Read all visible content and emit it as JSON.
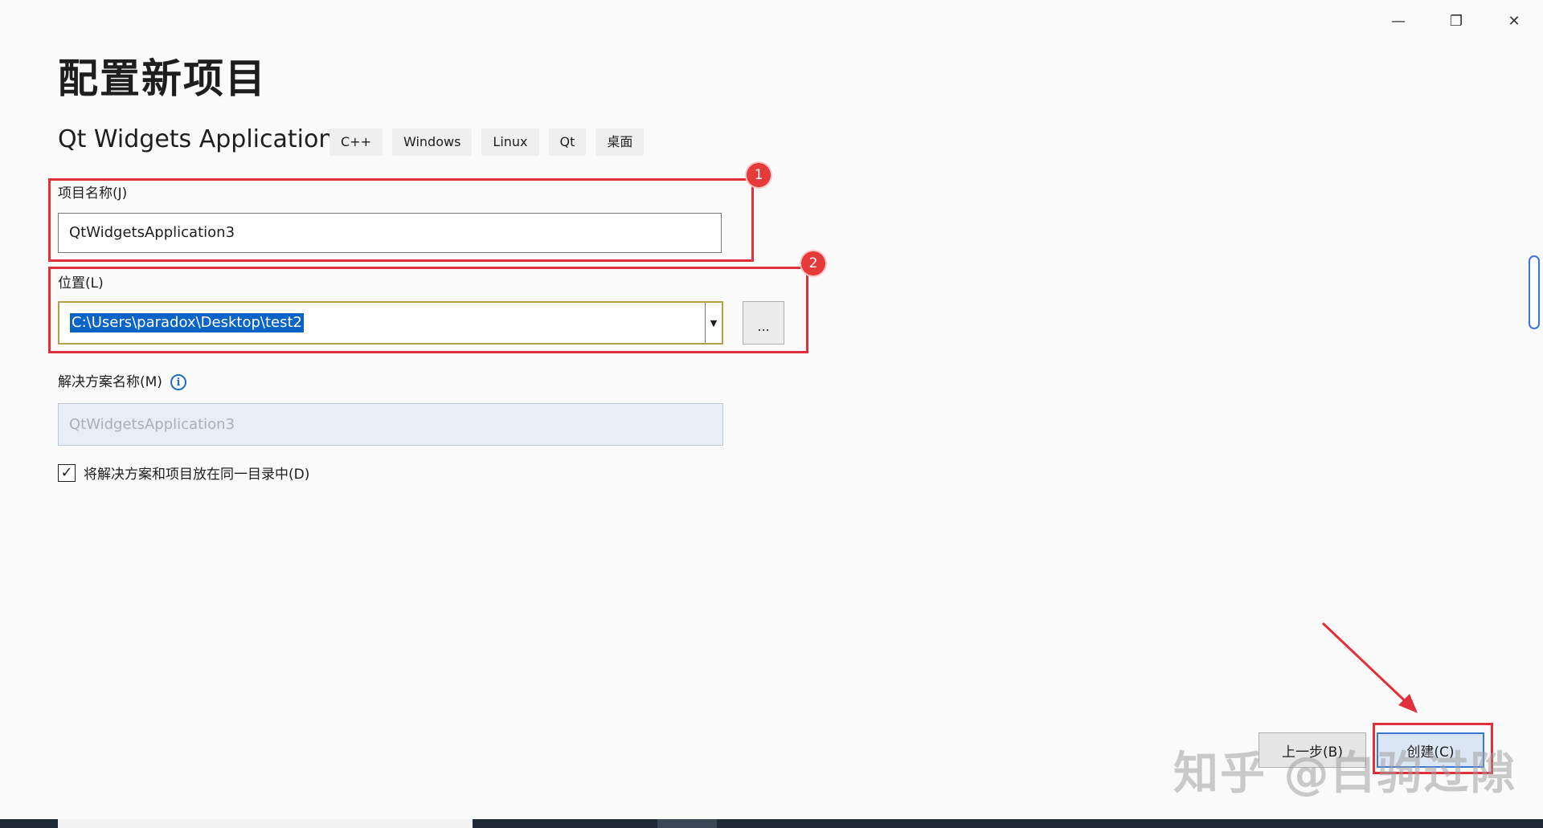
{
  "window": {
    "minimize_glyph": "—",
    "maximize_glyph": "❐",
    "close_glyph": "✕"
  },
  "header": {
    "title": "配置新项目",
    "template_name": "Qt Widgets Application",
    "tags": [
      "C++",
      "Windows",
      "Linux",
      "Qt",
      "桌面"
    ]
  },
  "form": {
    "project_name_label": "项目名称(J)",
    "project_name_value": "QtWidgetsApplication3",
    "location_label": "位置(L)",
    "location_value": "C:\\Users\\paradox\\Desktop\\test2",
    "browse_label": "...",
    "solution_name_label": "解决方案名称(M)",
    "solution_name_value": "QtWidgetsApplication3",
    "same_dir_checkbox_label": "将解决方案和项目放在同一目录中(D)",
    "same_dir_checked": true
  },
  "annotations": {
    "badge_1": "1",
    "badge_2": "2",
    "color": "#e0303a"
  },
  "footer": {
    "prev_button": "上一步(B)",
    "create_button": "创建(C)"
  },
  "watermark": "知乎 @白驹过隙",
  "colors": {
    "selection": "#0a64c8",
    "accent": "#3a78d6",
    "annotation_red": "#e0303a"
  }
}
